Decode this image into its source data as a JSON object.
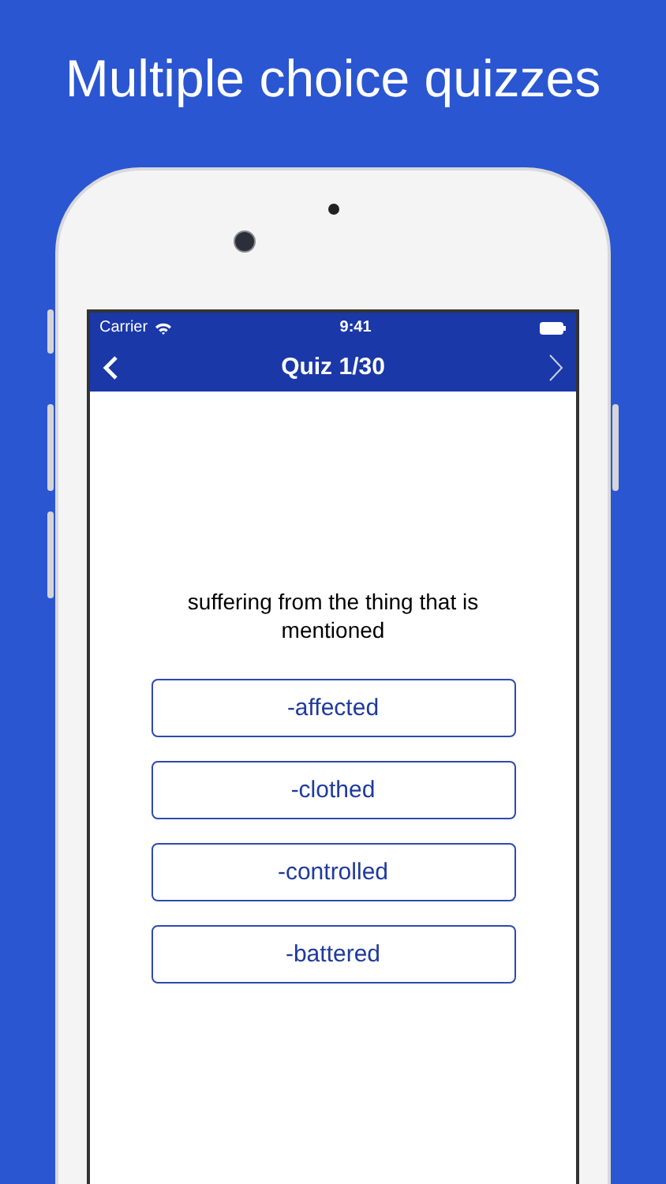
{
  "headline": "Multiple choice quizzes",
  "status_bar": {
    "carrier": "Carrier",
    "time": "9:41"
  },
  "nav_bar": {
    "title": "Quiz 1/30"
  },
  "question": "suffering from the thing that is mentioned",
  "answers": [
    {
      "label": "-affected"
    },
    {
      "label": "-clothed"
    },
    {
      "label": "-controlled"
    },
    {
      "label": "-battered"
    }
  ]
}
